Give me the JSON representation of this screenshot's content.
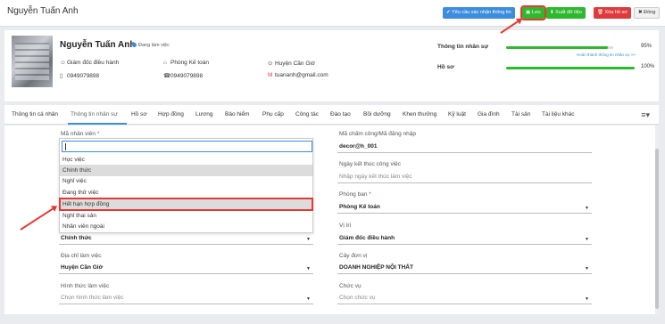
{
  "header": {
    "title": "Nguyễn Tuấn Anh",
    "buttons": {
      "request": "Yêu cầu xác nhận thông tin",
      "save": "Lưu",
      "export": "Xuất dữ liệu",
      "delete": "Xóa hồ sơ",
      "close": "Đóng"
    }
  },
  "profile": {
    "name": "Nguyễn Tuấn Anh",
    "status": "Đang làm việc",
    "position": "Giám đốc điều hành",
    "department": "Phòng Kế toán",
    "district": "Huyện Cần Giờ",
    "mobile": "0949079898",
    "phone": "0949079898",
    "email": "tuananh@gmail.com",
    "progress": {
      "hr_label": "Thông tin nhân sự",
      "hr_value": "95%",
      "hr_fraction": 0.95,
      "hr_link": "Hoàn thành thông tin nhân sự >>",
      "doc_label": "Hồ sơ",
      "doc_value": "100%",
      "doc_fraction": 1.0
    }
  },
  "tabs": [
    "Thông tin cá nhân",
    "Thông tin nhân sự",
    "Hồ sơ",
    "Hợp đồng",
    "Lương",
    "Bảo hiểm",
    "Phụ cấp",
    "Công tác",
    "Đào tạo",
    "Bồi dưỡng",
    "Khen thưởng",
    "Kỷ luật",
    "Gia đình",
    "Tài sản",
    "Tài liệu khác"
  ],
  "form": {
    "employee_code_label": "Mã nhân viên",
    "required_mark": "*",
    "dropdown_options": [
      "Học việc",
      "Chính thức",
      "Nghỉ việc",
      "Đang thử việc",
      "Hết hạn hợp đồng",
      "Nghỉ thai sản",
      "Nhân viên ngoài"
    ],
    "status_value": "Chính thức",
    "workplace_label": "Địa chỉ làm việc",
    "workplace_value": "Huyện Cần Giờ",
    "work_form_label": "Hình thức làm việc",
    "work_form_placeholder": "Chọn hình thức làm việc",
    "timekeeping_label": "Mã chấm công/Mã đăng nhập",
    "timekeeping_value": "decor@h_001",
    "end_date_label": "Ngày kết thúc công việc",
    "end_date_placeholder": "Nhập ngày kết thúc làm việc",
    "department_label": "Phòng ban",
    "department_value": "Phòng Kế toán",
    "position_label": "Vị trí",
    "position_value": "Giám đốc điều hành",
    "unit_tree_label": "Cây đơn vị",
    "unit_tree_value": "DOANH NGHIỆP NỘI THẤT",
    "title_label": "Chức vụ",
    "title_placeholder": "Chọn chức vụ"
  },
  "colors": {
    "accent": "#3c8dde",
    "success": "#2eb82e",
    "danger": "#e03b3b",
    "annotation": "#e53935"
  }
}
